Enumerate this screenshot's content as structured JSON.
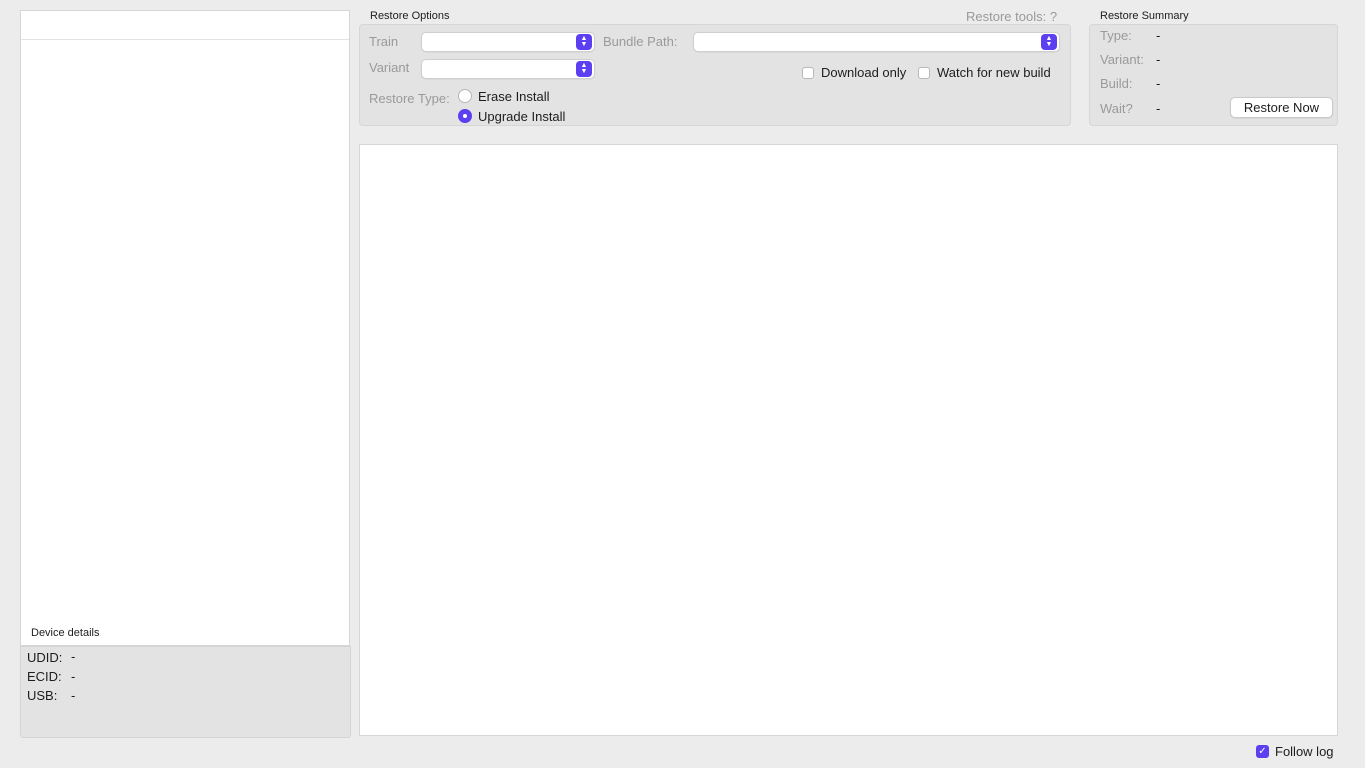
{
  "device_panel": {
    "details_title": "Device details",
    "rows": [
      {
        "key": "UDID:",
        "value": "-"
      },
      {
        "key": "ECID:",
        "value": "-"
      },
      {
        "key": "USB:",
        "value": "-"
      }
    ]
  },
  "restore_options": {
    "title": "Restore Options",
    "tools_status": "Restore tools: ?",
    "train_label": "Train",
    "train_value": "",
    "variant_label": "Variant",
    "variant_value": "",
    "bundle_path_label": "Bundle Path:",
    "bundle_path_value": "",
    "download_only_label": "Download only",
    "download_only_checked": false,
    "watch_label": "Watch for new build",
    "watch_checked": false,
    "restore_type_label": "Restore Type:",
    "restore_types": [
      {
        "label": "Erase Install",
        "selected": false
      },
      {
        "label": "Upgrade Install",
        "selected": true
      }
    ]
  },
  "restore_summary": {
    "title": "Restore Summary",
    "rows": [
      {
        "key": "Type:",
        "value": "-"
      },
      {
        "key": "Variant:",
        "value": "-"
      },
      {
        "key": "Build:",
        "value": "-"
      },
      {
        "key": "Wait?",
        "value": "-"
      }
    ],
    "restore_button": "Restore Now"
  },
  "log": {
    "follow_log_label": "Follow log",
    "follow_log_checked": true
  },
  "colors": {
    "accent": "#5b3ff0",
    "window_bg": "#ececec",
    "panel_bg": "#e3e3e3"
  }
}
